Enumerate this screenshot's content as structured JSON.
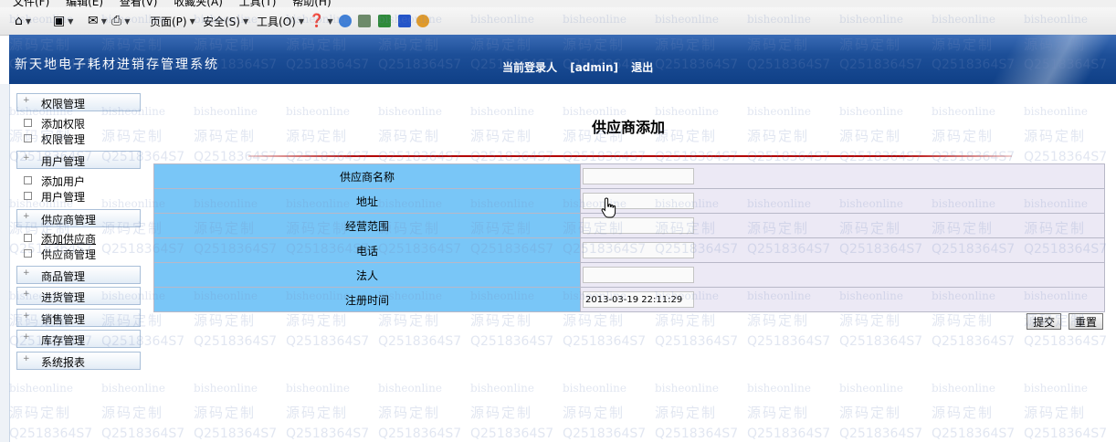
{
  "browser": {
    "menu": [
      "文件(F)",
      "编辑(E)",
      "查看(V)",
      "收藏夹(A)",
      "工具(T)",
      "帮助(H)"
    ],
    "commands": {
      "page_label": "页面(P)",
      "safety_label": "安全(S)",
      "tools_label": "工具(O)"
    },
    "icons": [
      "home-icon",
      "feeds-icon",
      "mail-icon",
      "print-icon",
      "help-icon",
      "messenger-icon",
      "research-icon",
      "onenote-icon",
      "bluetooth-icon",
      "extension-icon"
    ]
  },
  "header": {
    "app_title": "新天地电子耗材进销存管理系统",
    "login_label": "当前登录人",
    "user": "[admin]",
    "logout_label": "退出"
  },
  "sidebar": {
    "groups": [
      {
        "label": "权限管理",
        "items": [
          "添加权限",
          "权限管理"
        ]
      },
      {
        "label": "用户管理",
        "items": [
          "添加用户",
          "用户管理"
        ]
      },
      {
        "label": "供应商管理",
        "items": [
          "添加供应商",
          "供应商管理"
        ]
      },
      {
        "label": "商品管理",
        "items": []
      },
      {
        "label": "进货管理",
        "items": []
      },
      {
        "label": "销售管理",
        "items": []
      },
      {
        "label": "库存管理",
        "items": []
      },
      {
        "label": "系统报表",
        "items": []
      }
    ]
  },
  "main": {
    "page_title": "供应商添加",
    "fields": [
      {
        "label": "供应商名称",
        "value": ""
      },
      {
        "label": "地址",
        "value": ""
      },
      {
        "label": "经营范围",
        "value": ""
      },
      {
        "label": "电话",
        "value": ""
      },
      {
        "label": "法人",
        "value": ""
      },
      {
        "label": "注册时间",
        "value": "2013-03-19 22:11:29"
      }
    ],
    "submit_label": "提交",
    "reset_label": "重置"
  },
  "watermark": {
    "text_a": "bisheonline",
    "text_b": "源码定制",
    "text_c": "Q2518364S7"
  },
  "colors": {
    "banner": "#1d4f98",
    "label_cell": "#79c6f7",
    "value_cell": "#ece9f5",
    "title_rule": "#b30000"
  }
}
